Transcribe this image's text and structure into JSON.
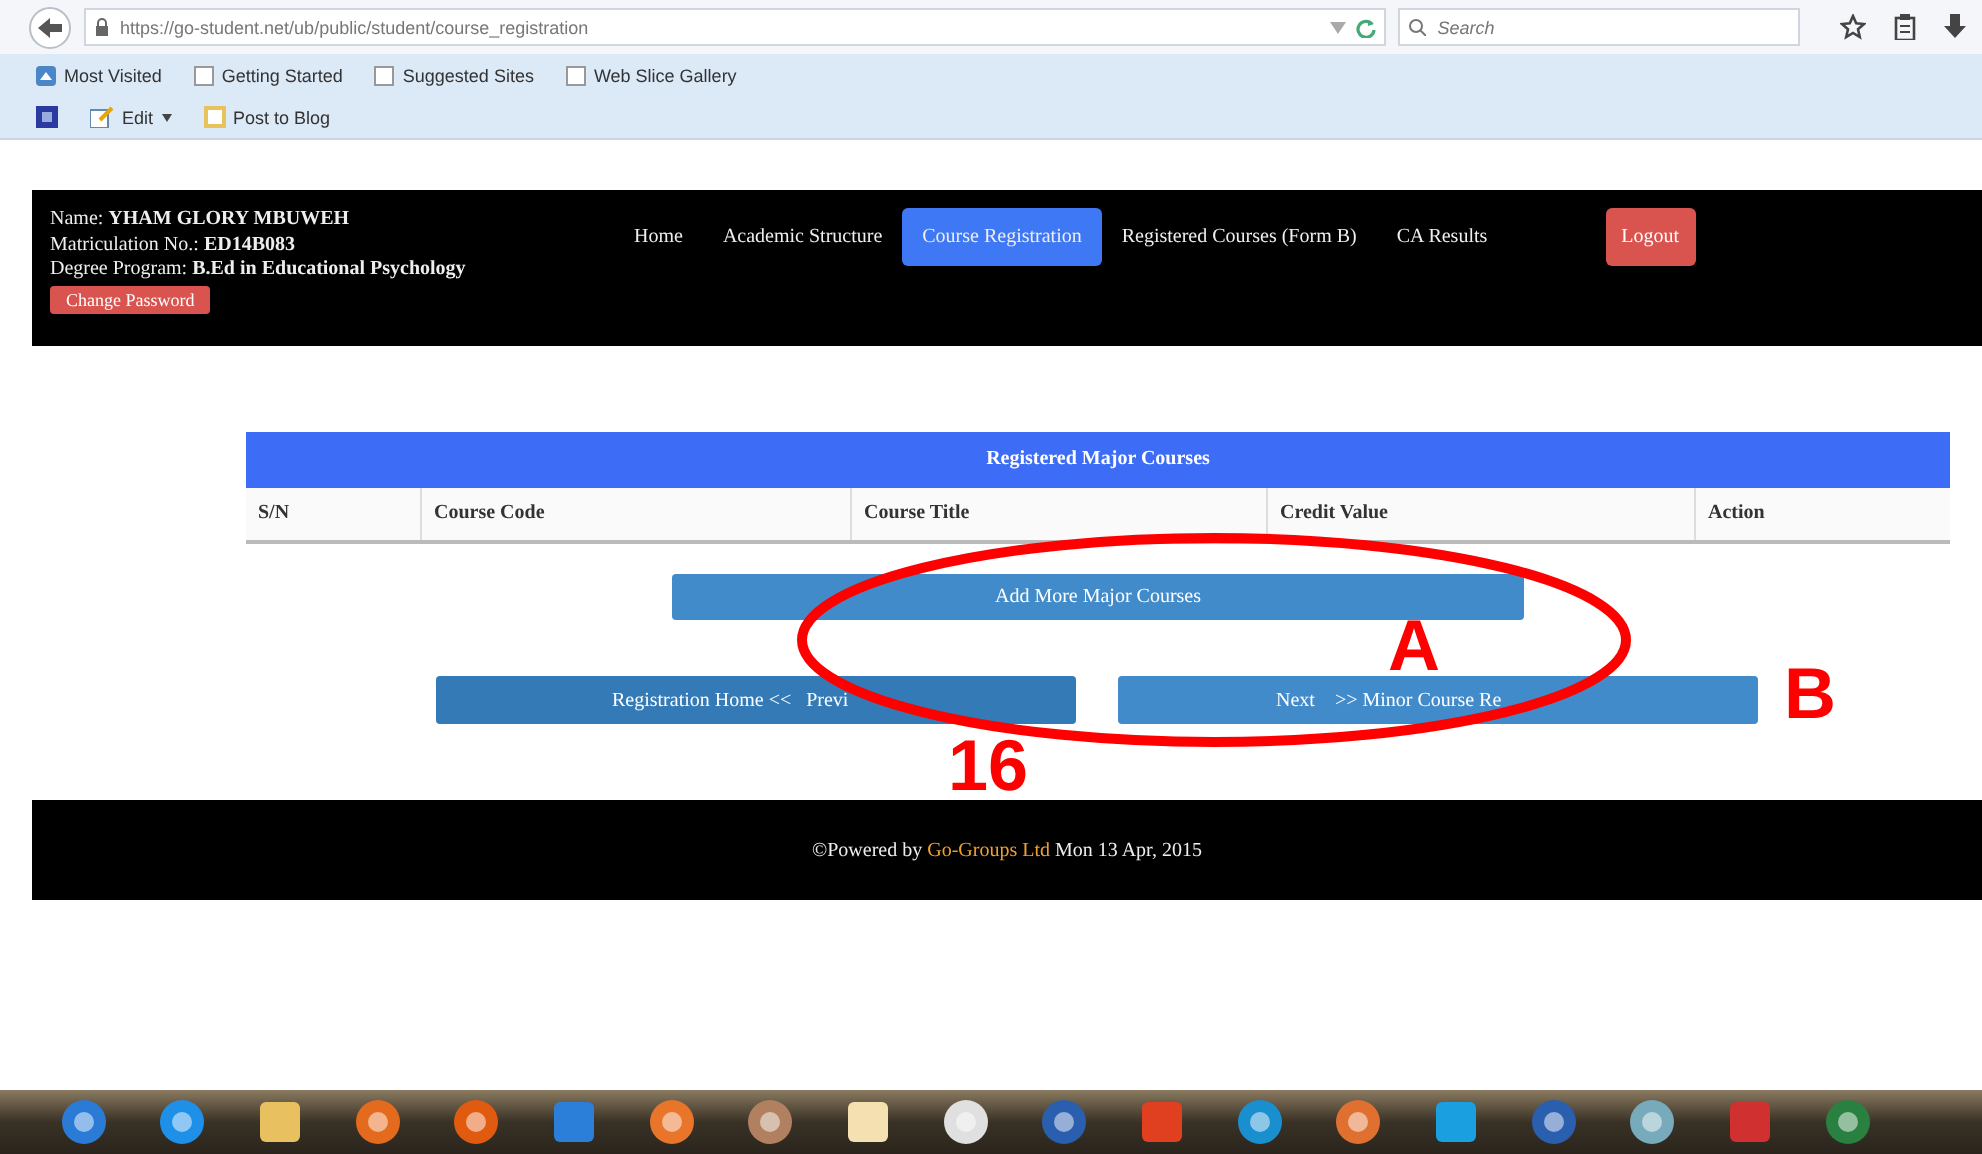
{
  "browser": {
    "url": "https://go-student.net/ub/public/student/course_registration",
    "search": {
      "placeholder": "Search"
    },
    "bookmarks": [
      "Most Visited",
      "Getting Started",
      "Suggested Sites",
      "Web Slice Gallery"
    ],
    "toolbar": [
      "Edit",
      "Post to Blog"
    ]
  },
  "header": {
    "info": [
      "Name: **YHAM GLORY MBUWEH**",
      "Matriculation No.: **ED14B083**",
      "Degree Program: **B.Ed in Educational Psychology**"
    ],
    "change_password": "Change Password",
    "nav": [
      {
        "label": "Home",
        "selected": false
      },
      {
        "label": "Academic Structure",
        "selected": false
      },
      {
        "label": "Course Registration",
        "selected": true
      },
      {
        "label": "Registered Courses (Form B)",
        "selected": false
      },
      {
        "label": "CA Results",
        "selected": false
      }
    ],
    "logout": "Logout"
  },
  "table": {
    "title": "Registered Major Courses",
    "columns": [
      "S/N",
      "Course Code",
      "Course Title",
      "Credit Value",
      "Action"
    ]
  },
  "actions": {
    "add": "Add More Major Courses",
    "previous": "Registration Home <<   Previ",
    "next": "Next    >> Minor Course Re"
  },
  "footer": {
    "prefix": "©Powered by",
    "company": "Go-Groups Ltd",
    "date": "Mon 13 Apr, 2015"
  },
  "annotations": [
    {
      "text": "A"
    },
    {
      "text": "B"
    },
    {
      "text": "16"
    }
  ]
}
